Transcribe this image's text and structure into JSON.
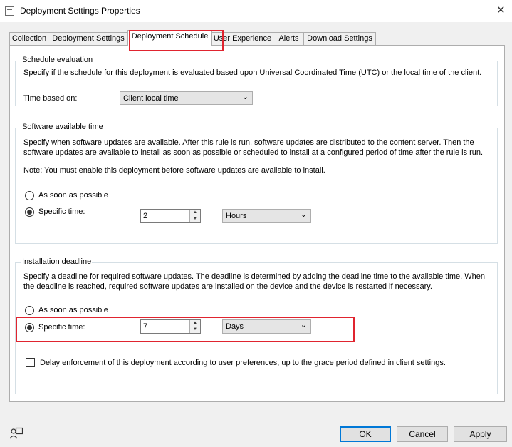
{
  "window": {
    "title": "Deployment Settings Properties",
    "close_glyph": "✕"
  },
  "tabs": [
    {
      "label": "Collection"
    },
    {
      "label": "Deployment Settings"
    },
    {
      "label": "Deployment Schedule",
      "active": true
    },
    {
      "label": "User Experience"
    },
    {
      "label": "Alerts"
    },
    {
      "label": "Download Settings"
    }
  ],
  "schedule_evaluation": {
    "title": "Schedule evaluation",
    "description": "Specify if the schedule for this deployment is evaluated based upon Universal Coordinated Time (UTC) or the local time of the client.",
    "time_based_on_label": "Time based on:",
    "time_based_on_value": "Client local time"
  },
  "software_available": {
    "title": "Software available time",
    "description_line1": "Specify when software updates are available. After this rule is run, software updates are distributed to the content server. Then the",
    "description_line2": "software updates are available to install as soon as possible or scheduled to install at a configured period of time after the rule is run.",
    "note": "Note: You must enable this deployment before software updates are available to install.",
    "asap_label": "As soon as possible",
    "specific_label": "Specific time:",
    "selected": "specific",
    "amount": "2",
    "unit": "Hours"
  },
  "installation_deadline": {
    "title": "Installation deadline",
    "description_line1": "Specify a deadline for required software updates. The deadline is determined by adding the deadline time to the available time. When",
    "description_line2": "the deadline is reached, required software updates are installed on the device and the device is restarted if necessary.",
    "asap_label": "As soon as possible",
    "specific_label": "Specific time:",
    "selected": "specific",
    "amount": "7",
    "unit": "Days",
    "delay_enforcement_label": "Delay enforcement of this deployment according to user preferences, up to the grace period defined in client settings.",
    "delay_enforcement_checked": false
  },
  "buttons": {
    "ok": "OK",
    "cancel": "Cancel",
    "apply": "Apply"
  },
  "icons": {
    "help": "help-person-icon"
  },
  "colors": {
    "highlight": "#e0242f",
    "default_button_border": "#0078d7"
  }
}
